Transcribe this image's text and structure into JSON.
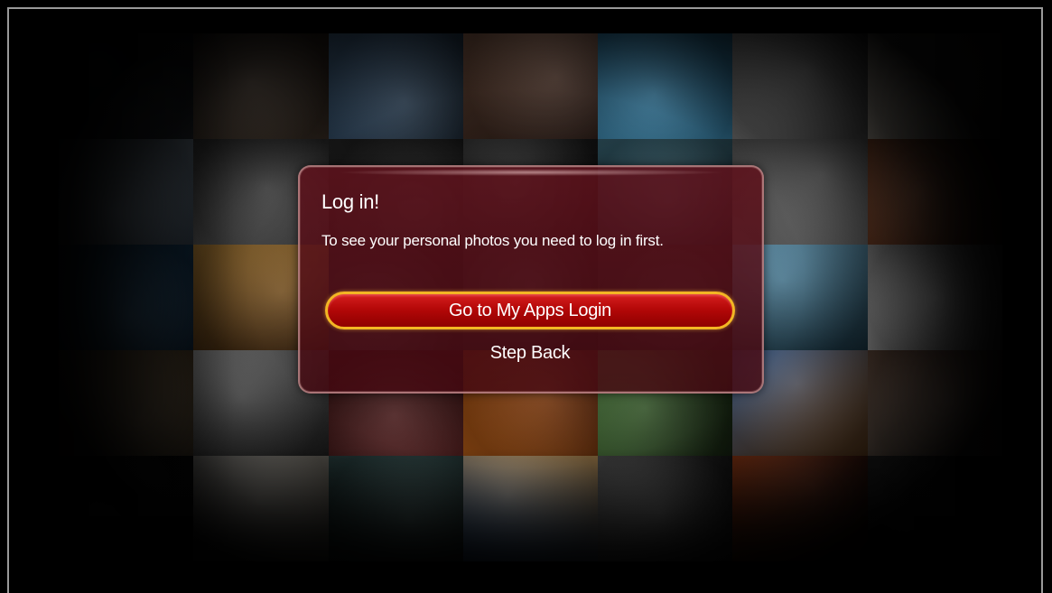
{
  "dialog": {
    "title": "Log in!",
    "message": "To see your personal photos you need to log in first.",
    "primary_button": "Go to My Apps Login",
    "secondary_button": "Step Back"
  },
  "colors": {
    "dialog_background": "#5f121c",
    "dialog_border": "#c89696",
    "button_fill": "#b40808",
    "button_border": "#f3b624",
    "text": "#ffffff",
    "screen_background": "#000000"
  },
  "background_tiles": [
    {
      "name": "tile-bridge-dusk",
      "c1": "#2a2f36",
      "c2": "#10141a"
    },
    {
      "name": "tile-hooded-figure",
      "c1": "#5a4a3c",
      "c2": "#1e1712"
    },
    {
      "name": "tile-letter-tiles",
      "c1": "#3c5a78",
      "c2": "#16222e"
    },
    {
      "name": "tile-brick-house",
      "c1": "#6a4a3a",
      "c2": "#2a1a14"
    },
    {
      "name": "tile-blue-sky-bubbles",
      "c1": "#3f8fb8",
      "c2": "#1d4d68"
    },
    {
      "name": "tile-bridge-bw",
      "c1": "#8a8a8a",
      "c2": "#3a3a3a"
    },
    {
      "name": "tile-piano-letters",
      "c1": "#cfc6b8",
      "c2": "#5a544c"
    },
    {
      "name": "tile-rubber-duck",
      "c1": "#9fb2c4",
      "c2": "#3c4a58"
    },
    {
      "name": "tile-industrial",
      "c1": "#6c6c6c",
      "c2": "#262626"
    },
    {
      "name": "tile-dark-1",
      "c1": "#2c2c2c",
      "c2": "#101010"
    },
    {
      "name": "tile-dark-2",
      "c1": "#2c2c2c",
      "c2": "#101010"
    },
    {
      "name": "tile-trees-sky",
      "c1": "#3c6a7a",
      "c2": "#14242a"
    },
    {
      "name": "tile-deer-lake",
      "c1": "#9a9a9a",
      "c2": "#3c3c3c"
    },
    {
      "name": "tile-squirrel",
      "c1": "#8a4a2a",
      "c2": "#2a140a"
    },
    {
      "name": "tile-blue-hand",
      "c1": "#2c6a9a",
      "c2": "#0c2236"
    },
    {
      "name": "tile-car",
      "c1": "#c08a3a",
      "c2": "#4a2c10"
    },
    {
      "name": "tile-dark-3",
      "c1": "#2c2c2c",
      "c2": "#101010"
    },
    {
      "name": "tile-dark-4",
      "c1": "#2c2c2c",
      "c2": "#101010"
    },
    {
      "name": "tile-dark-5",
      "c1": "#2c2c2c",
      "c2": "#101010"
    },
    {
      "name": "tile-penguin-toy",
      "c1": "#6aa8c8",
      "c2": "#24485a"
    },
    {
      "name": "tile-umbrella",
      "c1": "#e8e8e8",
      "c2": "#6a6a6a"
    },
    {
      "name": "tile-beach-walker",
      "c1": "#c4a47a",
      "c2": "#4a3a24"
    },
    {
      "name": "tile-man-hat",
      "c1": "#9a9a9a",
      "c2": "#2a2a2a"
    },
    {
      "name": "tile-piano-red",
      "c1": "#6a2a2a",
      "c2": "#2a0c0c"
    },
    {
      "name": "tile-fire-sunset",
      "c1": "#d06a1a",
      "c2": "#4a1a06"
    },
    {
      "name": "tile-daisy",
      "c1": "#4a7a3a",
      "c2": "#1a2a14"
    },
    {
      "name": "tile-eiffel",
      "c1": "#3a6aaa",
      "c2": "#c07a3a"
    },
    {
      "name": "tile-love-tattoo",
      "c1": "#d8b8a0",
      "c2": "#6a4a3a"
    },
    {
      "name": "tile-dark-6",
      "c1": "#2a2a2a",
      "c2": "#0c0c0c"
    },
    {
      "name": "tile-old-house",
      "c1": "#e0dcd4",
      "c2": "#8a8478"
    },
    {
      "name": "tile-girl-hall",
      "c1": "#3a5a5a",
      "c2": "#14201e"
    },
    {
      "name": "tile-mosque",
      "c1": "#3a6aaa",
      "c2": "#c89a5a"
    },
    {
      "name": "tile-two-girls",
      "c1": "#7a7a7a",
      "c2": "#1a1a1a"
    },
    {
      "name": "tile-red-orange",
      "c1": "#c04a1a",
      "c2": "#3a0c04"
    },
    {
      "name": "tile-dark-7",
      "c1": "#3a3a3a",
      "c2": "#0c0c0c"
    }
  ]
}
